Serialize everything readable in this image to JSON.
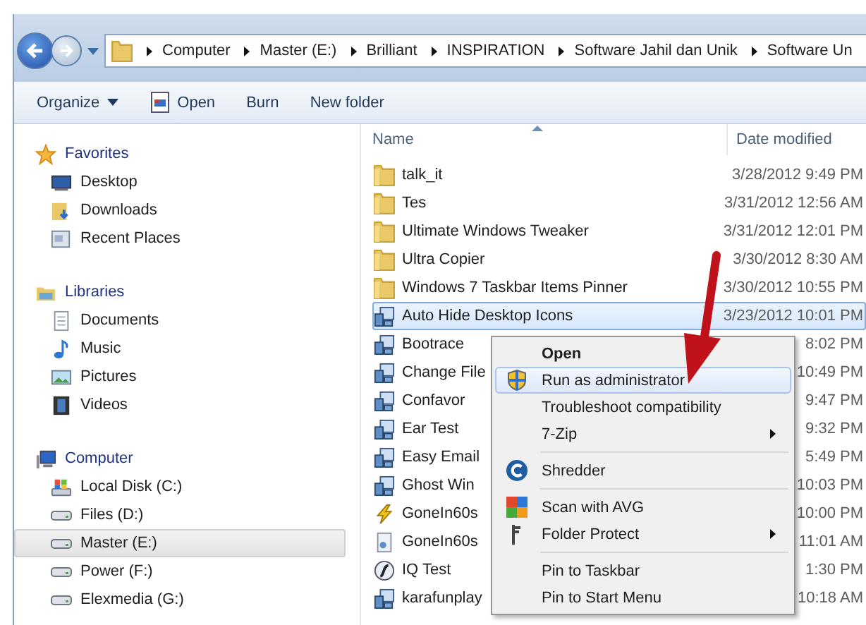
{
  "address_bar": {
    "segments": [
      "Computer",
      "Master (E:)",
      "Brilliant",
      "INSPIRATION",
      "Software Jahil dan Unik",
      "Software Un"
    ]
  },
  "toolbar": [
    {
      "label": "Organize",
      "kind": "dropdown"
    },
    {
      "label": "Open",
      "kind": "icon"
    },
    {
      "label": "Burn",
      "kind": "plain"
    },
    {
      "label": "New folder",
      "kind": "plain"
    }
  ],
  "sidebar": [
    {
      "label": "Favorites",
      "children": [
        {
          "label": "Desktop",
          "selected": false
        },
        {
          "label": "Downloads",
          "selected": false
        },
        {
          "label": "Recent Places",
          "selected": false
        }
      ]
    },
    {
      "label": "Libraries",
      "children": [
        {
          "label": "Documents",
          "selected": false
        },
        {
          "label": "Music",
          "selected": false
        },
        {
          "label": "Pictures",
          "selected": false
        },
        {
          "label": "Videos",
          "selected": false
        }
      ]
    },
    {
      "label": "Computer",
      "children": [
        {
          "label": "Local Disk (C:)",
          "selected": false
        },
        {
          "label": "Files (D:)",
          "selected": false
        },
        {
          "label": "Master (E:)",
          "selected": true
        },
        {
          "label": "Power (F:)",
          "selected": false
        },
        {
          "label": "Elexmedia (G:)",
          "selected": false
        }
      ]
    }
  ],
  "file_list": {
    "columns": [
      "Name",
      "Date modified"
    ],
    "rows": [
      {
        "name": "talk_it",
        "date": "3/28/2012 9:49 PM",
        "kind": "folder",
        "selected": false
      },
      {
        "name": "Tes",
        "date": "3/31/2012 12:56 AM",
        "kind": "folder",
        "selected": false
      },
      {
        "name": "Ultimate Windows Tweaker",
        "date": "3/31/2012 12:01 PM",
        "kind": "folder",
        "selected": false
      },
      {
        "name": "Ultra Copier",
        "date": "3/30/2012 8:30 AM",
        "kind": "folder",
        "selected": false
      },
      {
        "name": "Windows 7 Taskbar Items Pinner",
        "date": "3/30/2012 10:55 PM",
        "kind": "folder",
        "selected": false
      },
      {
        "name": "Auto Hide Desktop Icons",
        "date": "3/23/2012 10:01 PM",
        "kind": "app",
        "selected": true
      },
      {
        "name": "Bootrace",
        "date": "8:02 PM",
        "kind": "app",
        "selected": false
      },
      {
        "name": "Change File",
        "date": "10:49 PM",
        "kind": "app",
        "selected": false
      },
      {
        "name": "Confavor",
        "date": "9:47 PM",
        "kind": "app",
        "selected": false
      },
      {
        "name": "Ear Test",
        "date": "9:32 PM",
        "kind": "app",
        "selected": false
      },
      {
        "name": "Easy Email",
        "date": "5:49 PM",
        "kind": "app",
        "selected": false
      },
      {
        "name": "Ghost Win",
        "date": "10:03 PM",
        "kind": "app",
        "selected": false
      },
      {
        "name": "GoneIn60s",
        "date": "10:00 PM",
        "kind": "bolt",
        "selected": false
      },
      {
        "name": "GoneIn60s",
        "date": "11:01 AM",
        "kind": "file",
        "selected": false
      },
      {
        "name": "IQ Test",
        "date": "1:30 PM",
        "kind": "flash",
        "selected": false
      },
      {
        "name": "karafunplay",
        "date": "10:18 AM",
        "kind": "app",
        "selected": false
      }
    ]
  },
  "context_menu": [
    {
      "label": "Open",
      "kind": "default",
      "selected": false
    },
    {
      "label": "Run as administrator",
      "kind": "shield",
      "selected": true
    },
    {
      "label": "Troubleshoot compatibility",
      "kind": "plain",
      "selected": false
    },
    {
      "label": "7-Zip",
      "kind": "submenu",
      "selected": false
    },
    {
      "kind": "separator"
    },
    {
      "label": "Shredder",
      "kind": "shredder",
      "selected": false
    },
    {
      "kind": "separator"
    },
    {
      "label": "Scan with AVG",
      "kind": "avg",
      "selected": false
    },
    {
      "label": "Folder Protect",
      "kind": "key-submenu",
      "selected": false
    },
    {
      "kind": "separator"
    },
    {
      "label": "Pin to Taskbar",
      "kind": "plain",
      "selected": false
    },
    {
      "label": "Pin to Start Menu",
      "kind": "plain",
      "selected": false
    }
  ]
}
